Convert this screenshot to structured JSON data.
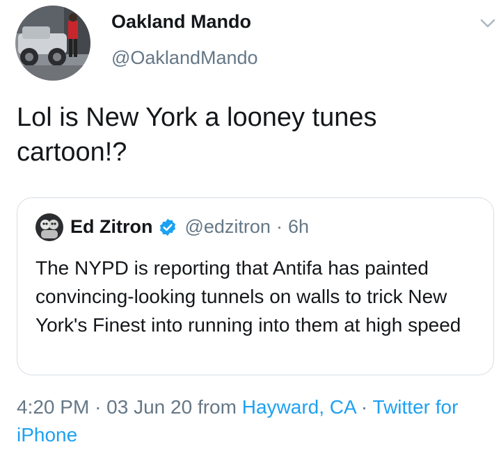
{
  "author": {
    "name": "Oakland Mando",
    "handle": "@OaklandMando"
  },
  "tweet": {
    "text": "Lol is New York a looney tunes cartoon!?"
  },
  "quoted_tweet": {
    "name": "Ed Zitron",
    "handle": "@edzitron",
    "separator": "·",
    "time": "6h",
    "text": "The NYPD is reporting that Antifa has painted convincing-looking tunnels on walls to trick New York's Finest into running into them at high speed"
  },
  "meta": {
    "time": "4:20 PM",
    "separator": "·",
    "date": "03 Jun 20",
    "from_label": "from",
    "location": "Hayward, CA",
    "source": "Twitter for iPhone"
  },
  "colors": {
    "link": "#1da1f2",
    "secondary_text": "#657786",
    "verified_badge": "#1da1f2",
    "border": "#d6dde3"
  },
  "icons": {
    "caret": "chevron-down-icon",
    "verified": "verified-badge-icon"
  }
}
